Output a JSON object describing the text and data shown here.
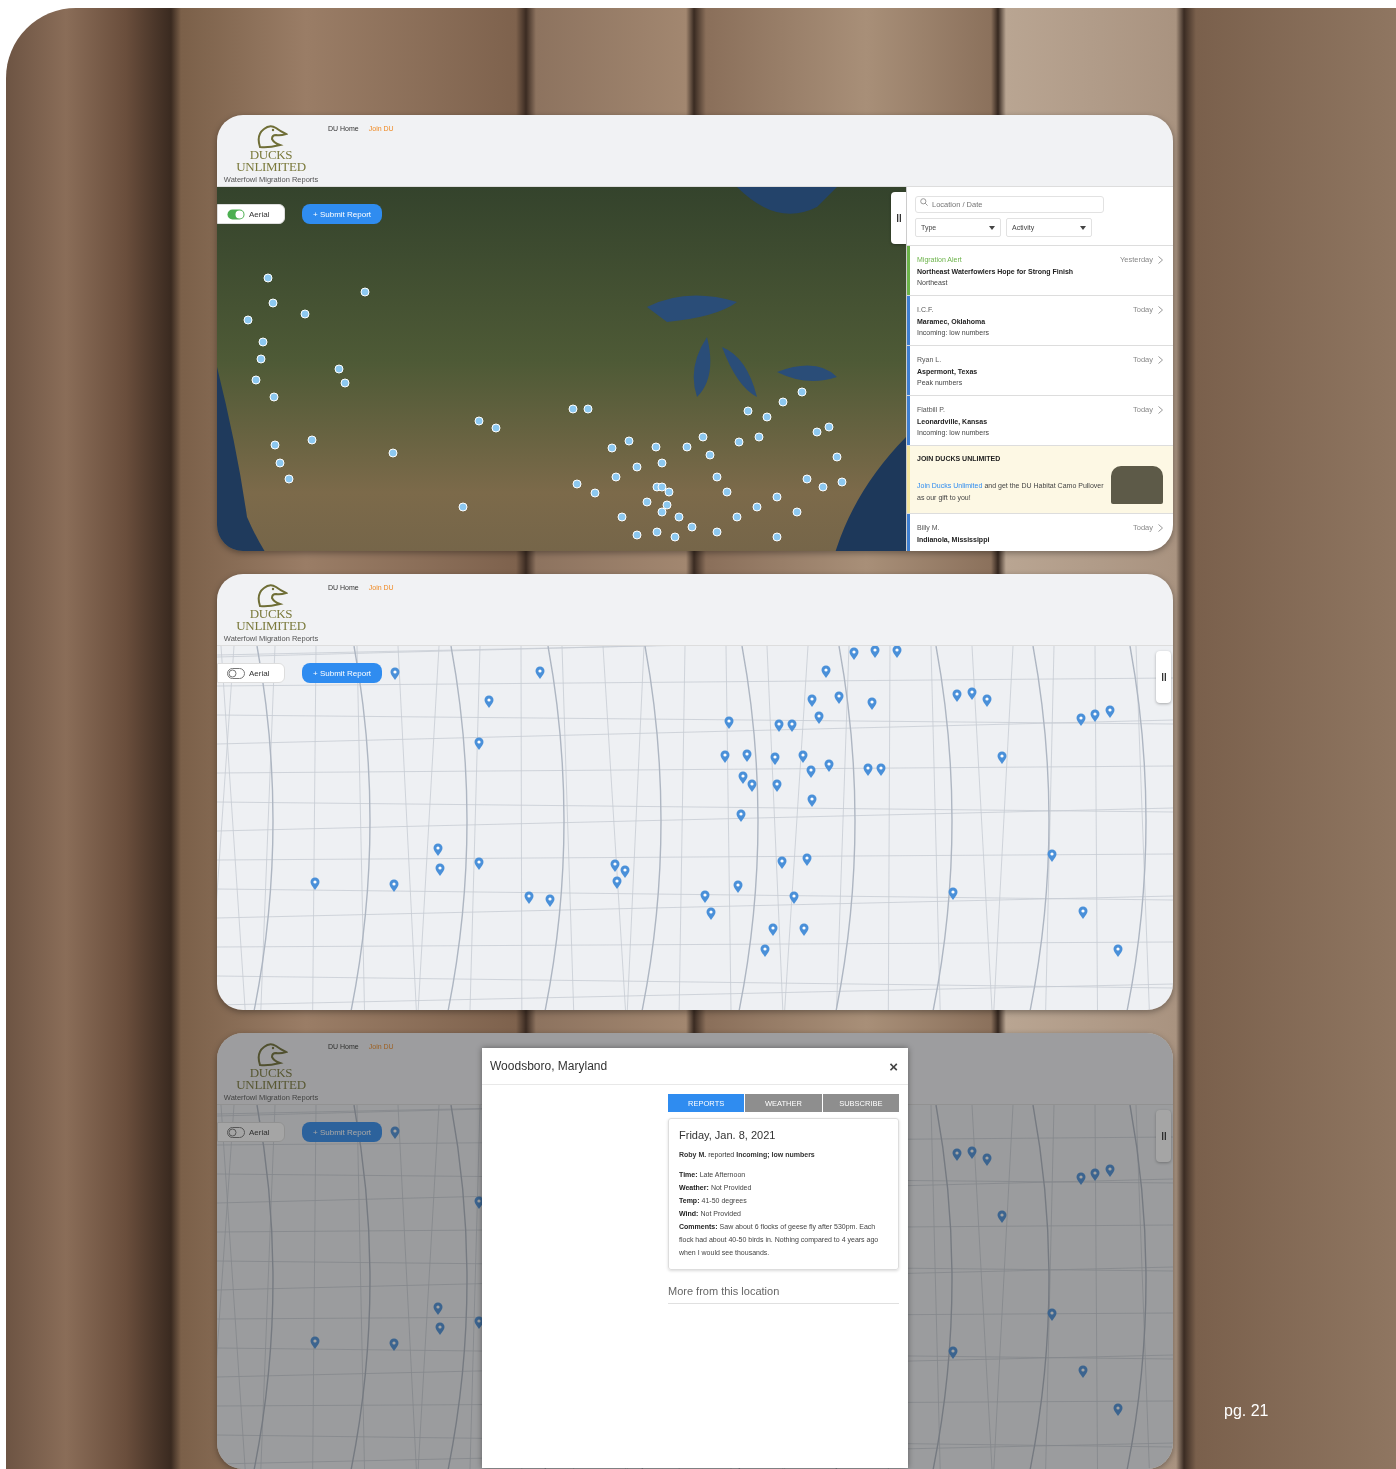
{
  "screens": [
    {
      "header": {
        "logo_lines": [
          "DUCKS",
          "UNLIMITED"
        ],
        "tagline": "Waterfowl Migration Reports",
        "nav": [
          {
            "label": "DU Home",
            "kind": "plain"
          },
          {
            "label": "Join DU",
            "kind": "accent"
          }
        ]
      },
      "map": {
        "aerial_toggle": {
          "label": "Aerial",
          "on": true
        },
        "submit_button": "+ Submit Report",
        "sidebar_open": true
      },
      "sidebar": {
        "search": {
          "placeholder": "Location / Date"
        },
        "filters": [
          "Type",
          "Activity"
        ],
        "items": [
          {
            "kind": "alert",
            "label": "Migration Alert",
            "time": "Yesterday",
            "title": "Northeast Waterfowlers Hope for Strong Finish",
            "subtitle": "Northeast",
            "color": "#6cb34a"
          },
          {
            "kind": "report",
            "label": "I.C.F.",
            "time": "Today",
            "title": "Maramec, Oklahoma",
            "subtitle": "Incoming: low numbers",
            "color": "#3f7fd0"
          },
          {
            "kind": "report",
            "label": "Ryan L.",
            "time": "Today",
            "title": "Aspermont, Texas",
            "subtitle": "Peak numbers",
            "color": "#3f7fd0"
          },
          {
            "kind": "report",
            "label": "Flatbill P.",
            "time": "Today",
            "title": "Leonardville, Kansas",
            "subtitle": "Incoming: low numbers",
            "color": "#3f7fd0"
          },
          {
            "kind": "promo",
            "label": "JOIN DUCKS UNLIMITED",
            "link": "Join Ducks Unlimited",
            "text": "and get the DU Habitat Camo Pullover as our gift to you!",
            "color": "#f3e6a0"
          },
          {
            "kind": "report",
            "label": "Billy M.",
            "time": "Today",
            "title": "Indianola, Mississippi",
            "color": "#3f7fd0"
          }
        ]
      }
    },
    {
      "header": {
        "logo_lines": [
          "DUCKS",
          "UNLIMITED"
        ],
        "tagline": "Waterfowl Migration Reports",
        "nav": [
          {
            "label": "DU Home",
            "kind": "plain"
          },
          {
            "label": "Join DU",
            "kind": "accent"
          }
        ]
      },
      "map": {
        "aerial_toggle": {
          "label": "Aerial",
          "on": false
        },
        "submit_button": "+ Submit Report",
        "sidebar_open": false
      }
    },
    {
      "header": {
        "logo_lines": [
          "DUCKS",
          "UNLIMITED"
        ],
        "tagline": "Waterfowl Migration Reports",
        "nav": [
          {
            "label": "DU Home",
            "kind": "plain"
          },
          {
            "label": "Join DU",
            "kind": "accent"
          }
        ]
      },
      "map": {
        "aerial_toggle": {
          "label": "Aerial",
          "on": false
        },
        "submit_button": "+ Submit Report",
        "sidebar_open": false
      },
      "modal": {
        "title": "Woodsboro, Maryland",
        "close": "×",
        "tabs": [
          {
            "label": "REPORTS",
            "selected": true
          },
          {
            "label": "WEATHER",
            "selected": false
          },
          {
            "label": "SUBSCRIBE",
            "selected": false
          }
        ],
        "report": {
          "date": "Friday, Jan. 8, 2021",
          "summary": "**Roby M.** reported **Incoming; low numbers**",
          "fields": [
            {
              "label": "Time:",
              "value": "Late Afternoon"
            },
            {
              "label": "Weather:",
              "value": "Not Provided"
            },
            {
              "label": "Temp:",
              "value": "41-50 degrees"
            },
            {
              "label": "Wind:",
              "value": "Not Provided"
            },
            {
              "label": "Comments:",
              "value": "Saw about 6 flocks of geese fly after 530pm. Each flock had about 40-50 birds in. Nothing compared to 4 years ago when I would see thousands."
            }
          ]
        },
        "more_heading": "More from this location"
      }
    }
  ],
  "page_number": "pg. 21"
}
